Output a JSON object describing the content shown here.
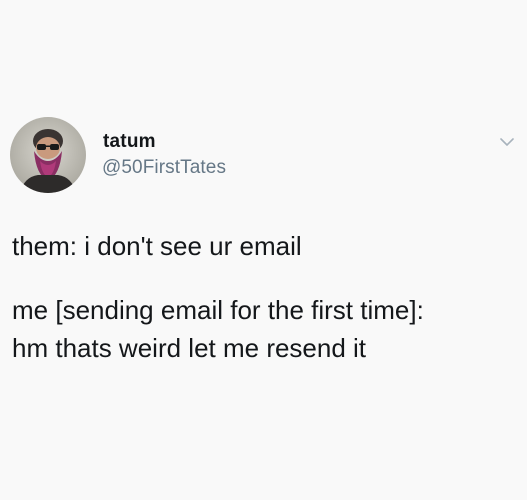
{
  "tweet": {
    "display_name": "tatum",
    "handle": "@50FirstTates",
    "avatar_icon": "avatar-bearded-man",
    "menu_icon": "chevron-down-icon",
    "lines": [
      "them: i don't see ur email",
      "me [sending email for the first time]:",
      "hm thats weird let me resend it"
    ]
  }
}
